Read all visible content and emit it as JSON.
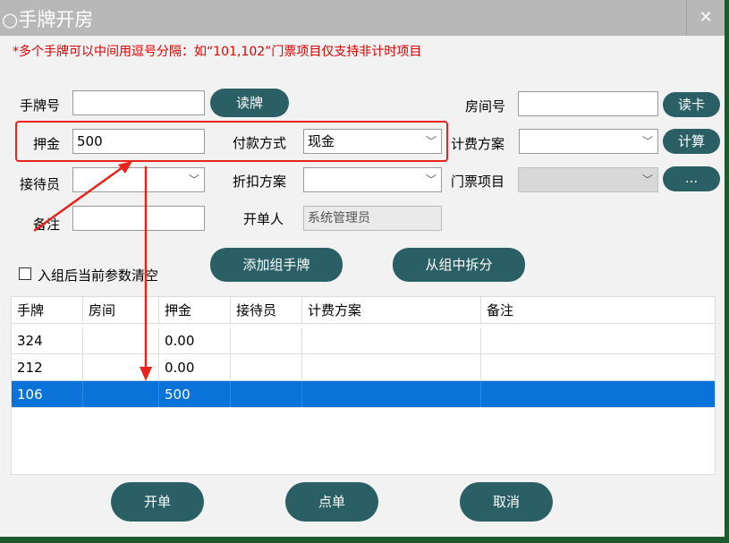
{
  "window": {
    "title": "○手牌开房",
    "close_glyph": "✕"
  },
  "hint": "*多个手牌可以中间用逗号分隔：如“101,102”门票项目仅支持非计时项目",
  "form": {
    "wristband_label": "手牌号",
    "wristband_value": "",
    "read_wristband_btn": "读牌",
    "room_label": "房间号",
    "room_value": "",
    "read_card_btn": "读卡",
    "deposit_label": "押金",
    "deposit_value": "500",
    "payment_label": "付款方式",
    "payment_value": "现金",
    "billing_label": "计费方案",
    "billing_value": "",
    "calc_btn": "计算",
    "receptionist_label": "接待员",
    "receptionist_value": "",
    "discount_label": "折扣方案",
    "discount_value": "",
    "ticket_label": "门票项目",
    "ticket_value": "",
    "more_btn": "...",
    "note_label": "备注",
    "note_value": "",
    "issuer_label": "开单人",
    "issuer_value": "系统管理员",
    "clear_checkbox_label": "入组后当前参数清空",
    "add_group_btn": "添加组手牌",
    "split_group_btn": "从组中拆分"
  },
  "table": {
    "columns": [
      "手牌",
      "房间",
      "押金",
      "接待员",
      "计费方案",
      "备注"
    ],
    "rows": [
      {
        "wristband": "324",
        "room": "",
        "deposit": "0.00",
        "receptionist": "",
        "billing": "",
        "note": ""
      },
      {
        "wristband": "212",
        "room": "",
        "deposit": "0.00",
        "receptionist": "",
        "billing": "",
        "note": ""
      },
      {
        "wristband": "106",
        "room": "",
        "deposit": "500",
        "receptionist": "",
        "billing": "",
        "note": ""
      }
    ],
    "selected_row": 2
  },
  "footer": {
    "open_btn": "开单",
    "order_btn": "点单",
    "cancel_btn": "取消"
  },
  "colors": {
    "button": "#2b5f66",
    "highlight": "#e8231b",
    "selected_row": "#0a73d9",
    "hint": "#e00000"
  }
}
